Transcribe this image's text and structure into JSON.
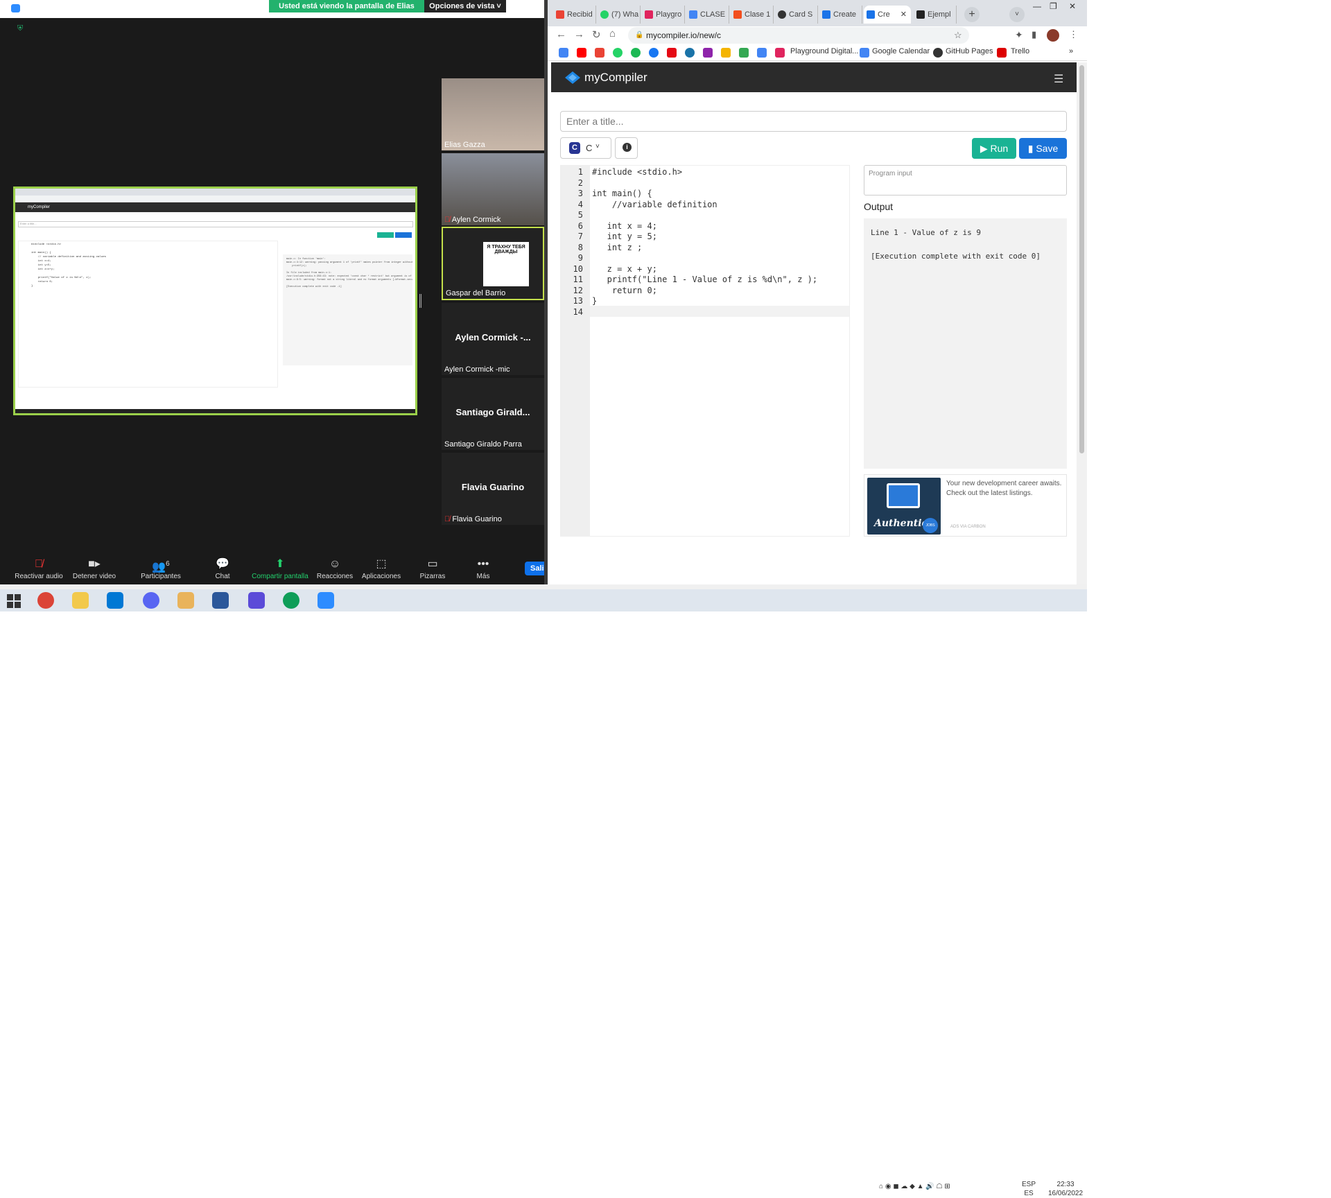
{
  "zoom": {
    "banner": "Usted está viendo la pantalla de Elias Gazza",
    "view_options": "Opciones de vista",
    "shared_screen": {
      "app_name": "myCompiler",
      "title_placeholder": "Enter a title...",
      "code": "#include <stdio.h>\n\nint main() {\n    // variable definition and assiing values\n    int x=4;\n    int y=5;\n    int z=x+y;\n\n    printf(\"Value of z is %d\\n\", z);\n    return 0;\n}",
      "output": "main.c: In function 'main':\nmain.c:4:12: warning: passing argument 1 of 'printf' makes pointer from integer without a cast [-Wint-conversion]\n    printf(z);\n\nIn file included from main.c:1:\n/usr/include/stdio.h:356:43: note: expected 'const char * restrict' but argument is of type 'int'\nmain.c:9:5: warning: format not a string literal and no format arguments [-Wformat-security]\n\n[Execution complete with exit code -1]"
    },
    "participants": [
      {
        "name": "Elias Gazza",
        "type": "video"
      },
      {
        "name": "Aylen Cormick",
        "type": "video",
        "muted": true
      },
      {
        "name": "Gaspar del Barrio",
        "type": "image",
        "image_text": "Я ТРАХНУ ТЕБЯ ДВАЖДЫ"
      },
      {
        "name": "Aylen Cormick -mic",
        "big": "Aylen Cormick -..."
      },
      {
        "name": "Santiago Giraldo Parra",
        "big": "Santiago  Girald..."
      },
      {
        "name": "Flavia Guarino",
        "big": "Flavia Guarino",
        "muted": true
      }
    ],
    "toolbar": [
      {
        "label": "Reactivar audio",
        "icon": "mic-muted-icon"
      },
      {
        "label": "Detener video",
        "icon": "video-icon"
      },
      {
        "label": "Participantes",
        "icon": "participants-icon",
        "count": "6"
      },
      {
        "label": "Chat",
        "icon": "chat-icon"
      },
      {
        "label": "Compartir pantalla",
        "icon": "share-screen-icon"
      },
      {
        "label": "Reacciones",
        "icon": "reactions-icon"
      },
      {
        "label": "Aplicaciones",
        "icon": "apps-icon"
      },
      {
        "label": "Pizarras",
        "icon": "whiteboard-icon"
      },
      {
        "label": "Más",
        "icon": "more-icon"
      }
    ],
    "leave": "Salir"
  },
  "browser": {
    "tabs": [
      "Recibid",
      "(7) Wha",
      "Playgro",
      "CLASE",
      "Clase 1",
      "Card S",
      "Create",
      "Cre",
      "Ejempl"
    ],
    "url": "mycompiler.io/new/c",
    "bookmarks": [
      "Playground Digital...",
      "Google Calendar",
      "GitHub Pages",
      "Trello"
    ]
  },
  "page": {
    "app_name": "myCompiler",
    "title_placeholder": "Enter a title...",
    "language": "C",
    "run": "Run",
    "save": "Save",
    "code_lines": [
      "#include <stdio.h>",
      "",
      "int main() {",
      "    //variable definition",
      "",
      "   int x = 4;",
      "   int y = 5;",
      "   int z ;",
      "",
      "   z = x + y;",
      "   printf(\"Line 1 - Value of z is %d\\n\", z );",
      "    return 0;",
      "}",
      ""
    ],
    "program_input_placeholder": "Program input",
    "output_label": "Output",
    "output": "Line 1 - Value of z is 9\n\n[Execution complete with exit code 0]",
    "ad": {
      "text": "Your new development career awaits. Check out the latest listings.",
      "brand": "Authentic",
      "badge": "JOBS",
      "footer": "ADS VIA CARBON"
    }
  },
  "taskbar": {
    "lang": "ESP",
    "lang2": "ES",
    "time": "22:33",
    "date": "16/06/2022"
  },
  "colors": {
    "zoom_green": "#23b26d",
    "run_green": "#1ab394",
    "save_blue": "#1a73d9"
  }
}
